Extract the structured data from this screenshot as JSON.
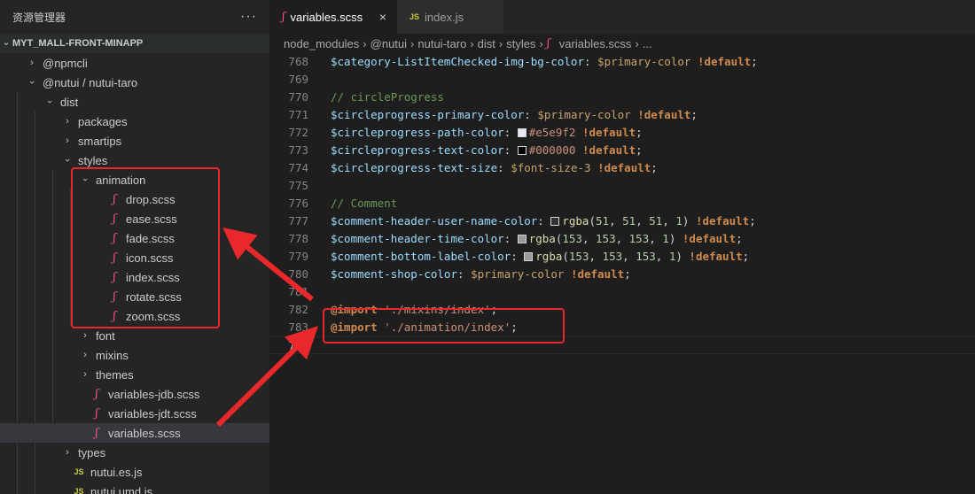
{
  "sidebar": {
    "title": "资源管理器",
    "more": "···",
    "project": "MYT_MALL-FRONT-MINAPP",
    "items": [
      {
        "label": "@npmcli",
        "depth": 1,
        "type": "folder",
        "open": false
      },
      {
        "label": "@nutui / nutui-taro",
        "depth": 1,
        "type": "folder",
        "open": true
      },
      {
        "label": "dist",
        "depth": 2,
        "type": "folder",
        "open": true
      },
      {
        "label": "packages",
        "depth": 3,
        "type": "folder",
        "open": false
      },
      {
        "label": "smartips",
        "depth": 3,
        "type": "folder",
        "open": false
      },
      {
        "label": "styles",
        "depth": 3,
        "type": "folder",
        "open": true
      },
      {
        "label": "animation",
        "depth": 4,
        "type": "folder",
        "open": true
      },
      {
        "label": "drop.scss",
        "depth": 5,
        "type": "scss"
      },
      {
        "label": "ease.scss",
        "depth": 5,
        "type": "scss"
      },
      {
        "label": "fade.scss",
        "depth": 5,
        "type": "scss"
      },
      {
        "label": "icon.scss",
        "depth": 5,
        "type": "scss"
      },
      {
        "label": "index.scss",
        "depth": 5,
        "type": "scss"
      },
      {
        "label": "rotate.scss",
        "depth": 5,
        "type": "scss"
      },
      {
        "label": "zoom.scss",
        "depth": 5,
        "type": "scss"
      },
      {
        "label": "font",
        "depth": 4,
        "type": "folder",
        "open": false
      },
      {
        "label": "mixins",
        "depth": 4,
        "type": "folder",
        "open": false
      },
      {
        "label": "themes",
        "depth": 4,
        "type": "folder",
        "open": false
      },
      {
        "label": "variables-jdb.scss",
        "depth": 4,
        "type": "scss"
      },
      {
        "label": "variables-jdt.scss",
        "depth": 4,
        "type": "scss"
      },
      {
        "label": "variables.scss",
        "depth": 4,
        "type": "scss",
        "selected": true
      },
      {
        "label": "types",
        "depth": 3,
        "type": "folder",
        "open": false
      },
      {
        "label": "nutui.es.js",
        "depth": 3,
        "type": "js"
      },
      {
        "label": "nutui.umd.js",
        "depth": 3,
        "type": "js"
      }
    ]
  },
  "tabs": [
    {
      "label": "variables.scss",
      "icon": "sass-icon",
      "active": true,
      "close": "×"
    },
    {
      "label": "index.js",
      "icon": "js-icon",
      "active": false
    }
  ],
  "breadcrumb": [
    "node_modules",
    "@nutui",
    "nutui-taro",
    "dist",
    "styles",
    "variables.scss",
    "..."
  ],
  "code": [
    {
      "n": "768",
      "t": [
        [
          "var",
          "$category-ListItemChecked-img-bg-color"
        ],
        [
          "punct",
          ": "
        ],
        [
          "var2",
          "$primary-color"
        ],
        [
          "punct",
          " "
        ],
        [
          "def",
          "!default"
        ],
        [
          "punct",
          ";"
        ]
      ]
    },
    {
      "n": "769",
      "t": []
    },
    {
      "n": "770",
      "t": [
        [
          "com",
          "// circleProgress"
        ]
      ]
    },
    {
      "n": "771",
      "t": [
        [
          "var",
          "$circleprogress-primary-color"
        ],
        [
          "punct",
          ": "
        ],
        [
          "var2",
          "$primary-color"
        ],
        [
          "punct",
          " "
        ],
        [
          "def",
          "!default"
        ],
        [
          "punct",
          ";"
        ]
      ]
    },
    {
      "n": "772",
      "t": [
        [
          "var",
          "$circleprogress-path-color"
        ],
        [
          "punct",
          ": "
        ],
        [
          "swatch",
          "#e5e9f2"
        ],
        [
          "str",
          "#e5e9f2"
        ],
        [
          "punct",
          " "
        ],
        [
          "def",
          "!default"
        ],
        [
          "punct",
          ";"
        ]
      ]
    },
    {
      "n": "773",
      "t": [
        [
          "var",
          "$circleprogress-text-color"
        ],
        [
          "punct",
          ": "
        ],
        [
          "swatch",
          "#000000"
        ],
        [
          "str",
          "#000000"
        ],
        [
          "punct",
          " "
        ],
        [
          "def",
          "!default"
        ],
        [
          "punct",
          ";"
        ]
      ]
    },
    {
      "n": "774",
      "t": [
        [
          "var",
          "$circleprogress-text-size"
        ],
        [
          "punct",
          ": "
        ],
        [
          "var2",
          "$font-size-3"
        ],
        [
          "punct",
          " "
        ],
        [
          "def",
          "!default"
        ],
        [
          "punct",
          ";"
        ]
      ]
    },
    {
      "n": "775",
      "t": []
    },
    {
      "n": "776",
      "t": [
        [
          "com",
          "// Comment"
        ]
      ]
    },
    {
      "n": "777",
      "t": [
        [
          "var",
          "$comment-header-user-name-color"
        ],
        [
          "punct",
          ": "
        ],
        [
          "swatch",
          "#333333"
        ],
        [
          "fn",
          "rgba"
        ],
        [
          "punct",
          "("
        ],
        [
          "num",
          "51"
        ],
        [
          "punct",
          ", "
        ],
        [
          "num",
          "51"
        ],
        [
          "punct",
          ", "
        ],
        [
          "num",
          "51"
        ],
        [
          "punct",
          ", "
        ],
        [
          "num",
          "1"
        ],
        [
          "punct",
          ") "
        ],
        [
          "def",
          "!default"
        ],
        [
          "punct",
          ";"
        ]
      ]
    },
    {
      "n": "778",
      "t": [
        [
          "var",
          "$comment-header-time-color"
        ],
        [
          "punct",
          ": "
        ],
        [
          "swatch",
          "#999999"
        ],
        [
          "fn",
          "rgba"
        ],
        [
          "punct",
          "("
        ],
        [
          "num",
          "153"
        ],
        [
          "punct",
          ", "
        ],
        [
          "num",
          "153"
        ],
        [
          "punct",
          ", "
        ],
        [
          "num",
          "153"
        ],
        [
          "punct",
          ", "
        ],
        [
          "num",
          "1"
        ],
        [
          "punct",
          ") "
        ],
        [
          "def",
          "!default"
        ],
        [
          "punct",
          ";"
        ]
      ]
    },
    {
      "n": "779",
      "t": [
        [
          "var",
          "$comment-bottom-label-color"
        ],
        [
          "punct",
          ": "
        ],
        [
          "swatch",
          "#999999"
        ],
        [
          "fn",
          "rgba"
        ],
        [
          "punct",
          "("
        ],
        [
          "num",
          "153"
        ],
        [
          "punct",
          ", "
        ],
        [
          "num",
          "153"
        ],
        [
          "punct",
          ", "
        ],
        [
          "num",
          "153"
        ],
        [
          "punct",
          ", "
        ],
        [
          "num",
          "1"
        ],
        [
          "punct",
          ") "
        ],
        [
          "def",
          "!default"
        ],
        [
          "punct",
          ";"
        ]
      ]
    },
    {
      "n": "780",
      "t": [
        [
          "var",
          "$comment-shop-color"
        ],
        [
          "punct",
          ": "
        ],
        [
          "var2",
          "$primary-color"
        ],
        [
          "punct",
          " "
        ],
        [
          "def",
          "!default"
        ],
        [
          "punct",
          ";"
        ]
      ]
    },
    {
      "n": "781",
      "t": []
    },
    {
      "n": "782",
      "t": [
        [
          "def",
          "@import"
        ],
        [
          "punct",
          " "
        ],
        [
          "str",
          "'./mixins/index'"
        ],
        [
          "punct",
          ";"
        ]
      ]
    },
    {
      "n": "783",
      "t": [
        [
          "def",
          "@import"
        ],
        [
          "punct",
          " "
        ],
        [
          "str",
          "'./animation/index'"
        ],
        [
          "punct",
          ";"
        ]
      ]
    },
    {
      "n": "784",
      "t": [],
      "current": true
    }
  ],
  "colors": {
    "annotation": "#e8282b",
    "sass_icon": "#f55385",
    "js_icon": "#cbcb41"
  }
}
